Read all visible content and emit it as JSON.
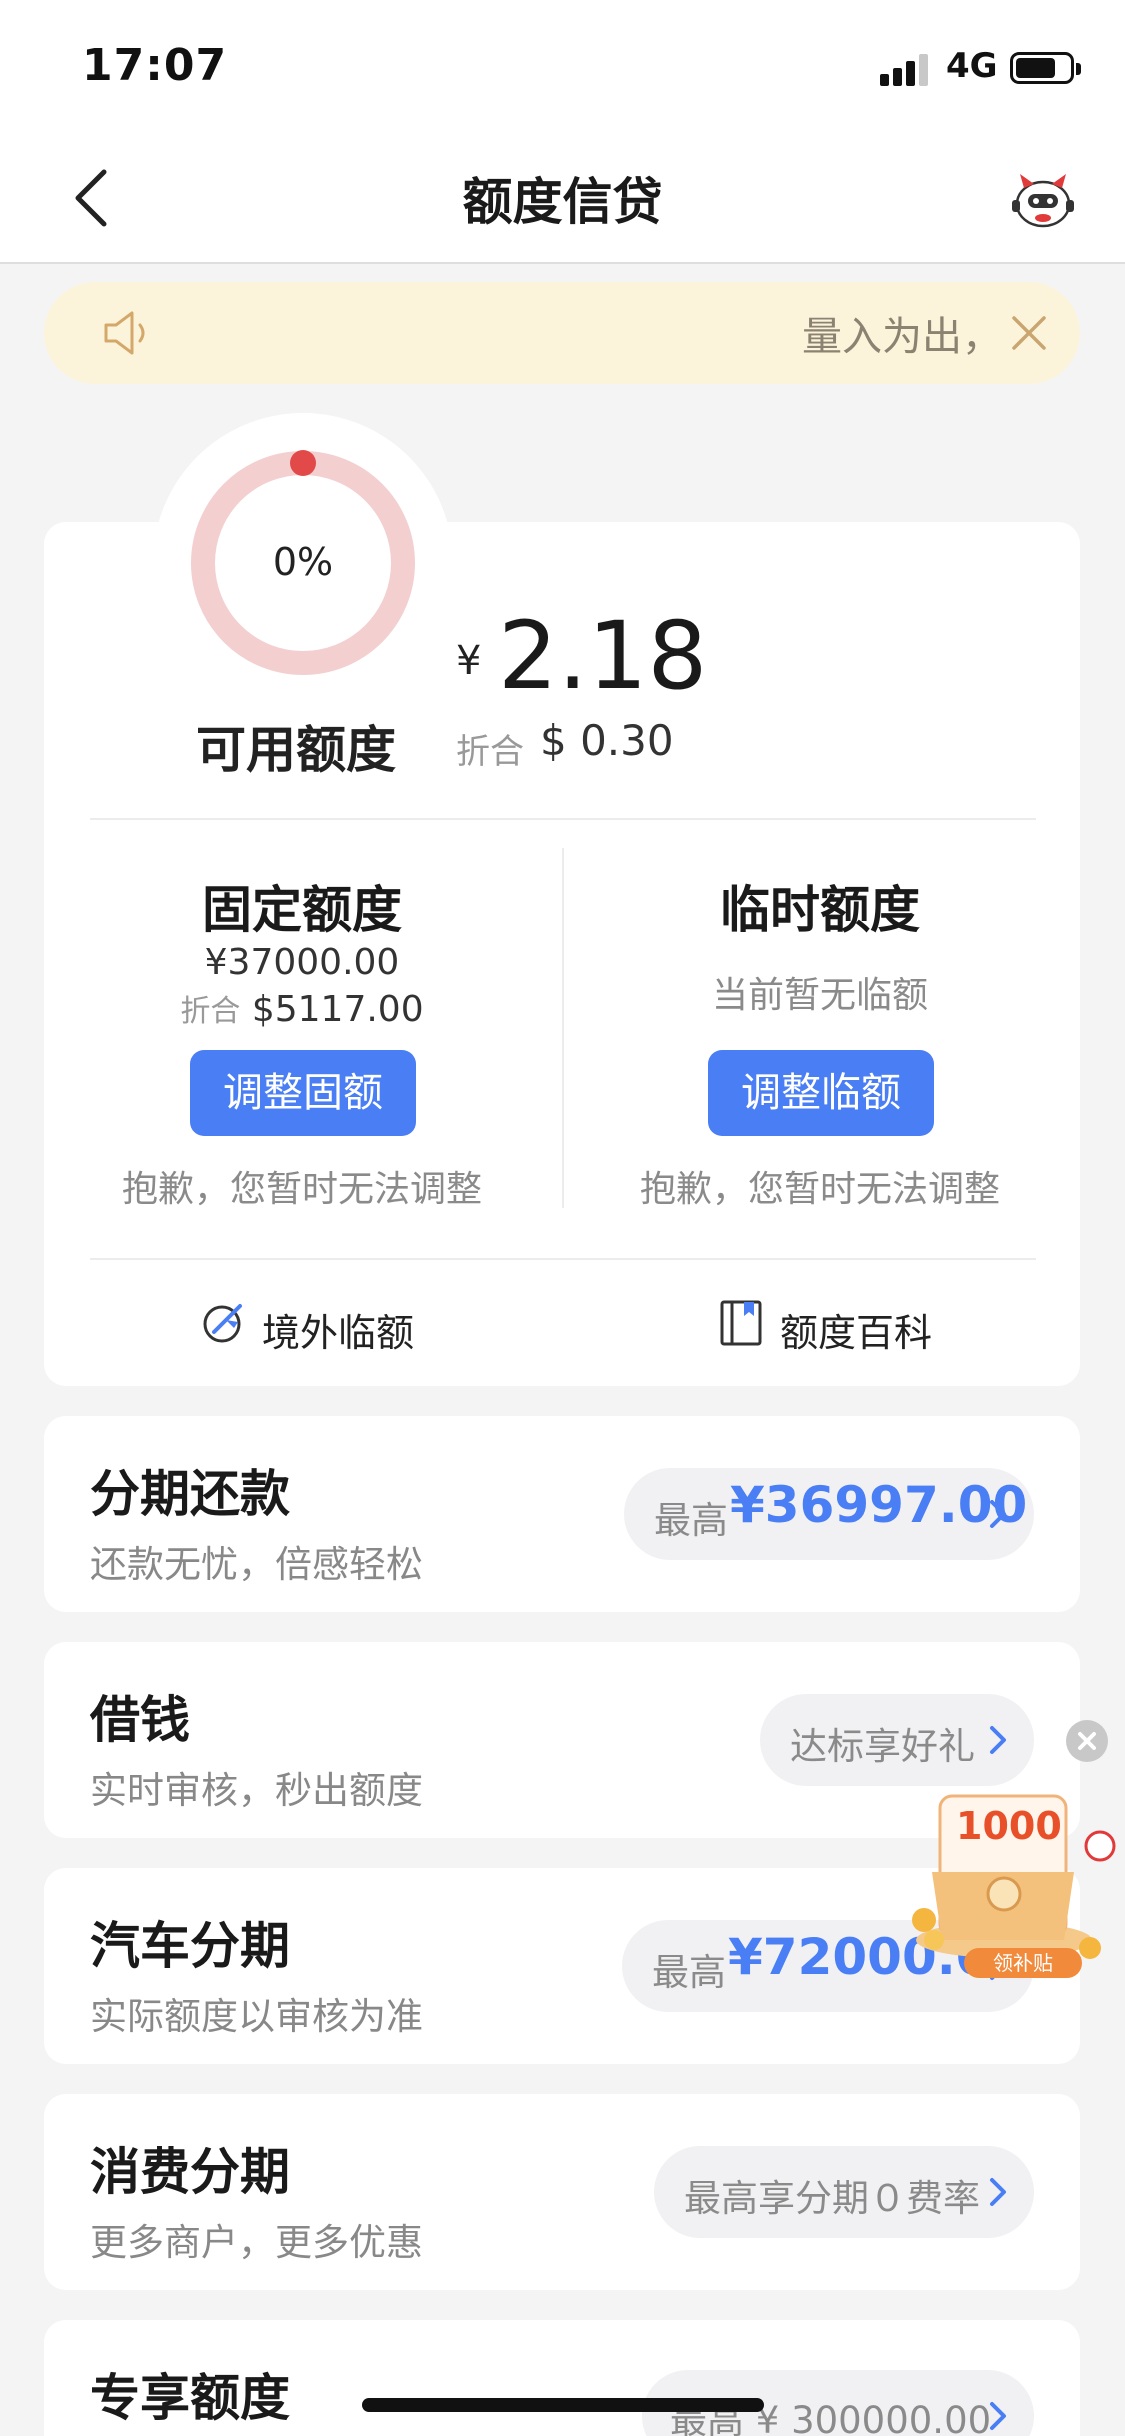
{
  "status_bar": {
    "time": "17:07",
    "network": "4G",
    "battery_level": 0.75
  },
  "header": {
    "title": "额度信贷",
    "back_icon": "chevron-left-icon",
    "mascot_icon": "mascot-icon"
  },
  "notice": {
    "text": "量入为出，",
    "speaker_icon": "speaker-icon",
    "close_icon": "close-icon"
  },
  "credit": {
    "usage_percent": "0%",
    "usage_fraction": 0.0,
    "available_label": "可用额度",
    "currency_symbol": "¥",
    "available_amount": "2.18",
    "converted_label": "折合",
    "converted_value": "$ 0.30",
    "colors": {
      "ring_track": "#f3cfcf",
      "ring_dot": "#e24a4a",
      "button": "#4a7ef4"
    }
  },
  "fixed_limit": {
    "title": "固定额度",
    "amount": "¥37000.00",
    "converted_label": "折合",
    "converted_value": "$5117.00",
    "button_label": "调整固额",
    "note": "抱歉，您暂时无法调整"
  },
  "temp_limit": {
    "title": "临时额度",
    "status": "当前暂无临额",
    "button_label": "调整临额",
    "note": "抱歉，您暂时无法调整"
  },
  "tools": [
    {
      "label": "境外临额",
      "icon": "globe-plane-icon"
    },
    {
      "label": "额度百科",
      "icon": "book-icon"
    }
  ],
  "products": [
    {
      "title": "分期还款",
      "subtitle": "还款无忧，倍感轻松",
      "pill_label": "最高",
      "pill_value": "¥36997.00"
    },
    {
      "title": "借钱",
      "subtitle": "实时审核，秒出额度",
      "pill_label": "达标享好礼",
      "pill_value": ""
    },
    {
      "title": "汽车分期",
      "subtitle": "实际额度以审核为准",
      "pill_label": "最高",
      "pill_value": "¥72000.00"
    },
    {
      "title": "消费分期",
      "subtitle": "更多商户，更多优惠",
      "pill_label": "最高享分期０费率",
      "pill_value": ""
    },
    {
      "title": "专享额度",
      "subtitle": "",
      "pill_label": "最高 ¥ 300000.00",
      "pill_value": ""
    }
  ],
  "promo": {
    "amount": "1000",
    "button": "领补贴",
    "icon": "red-envelope-gift-icon"
  }
}
